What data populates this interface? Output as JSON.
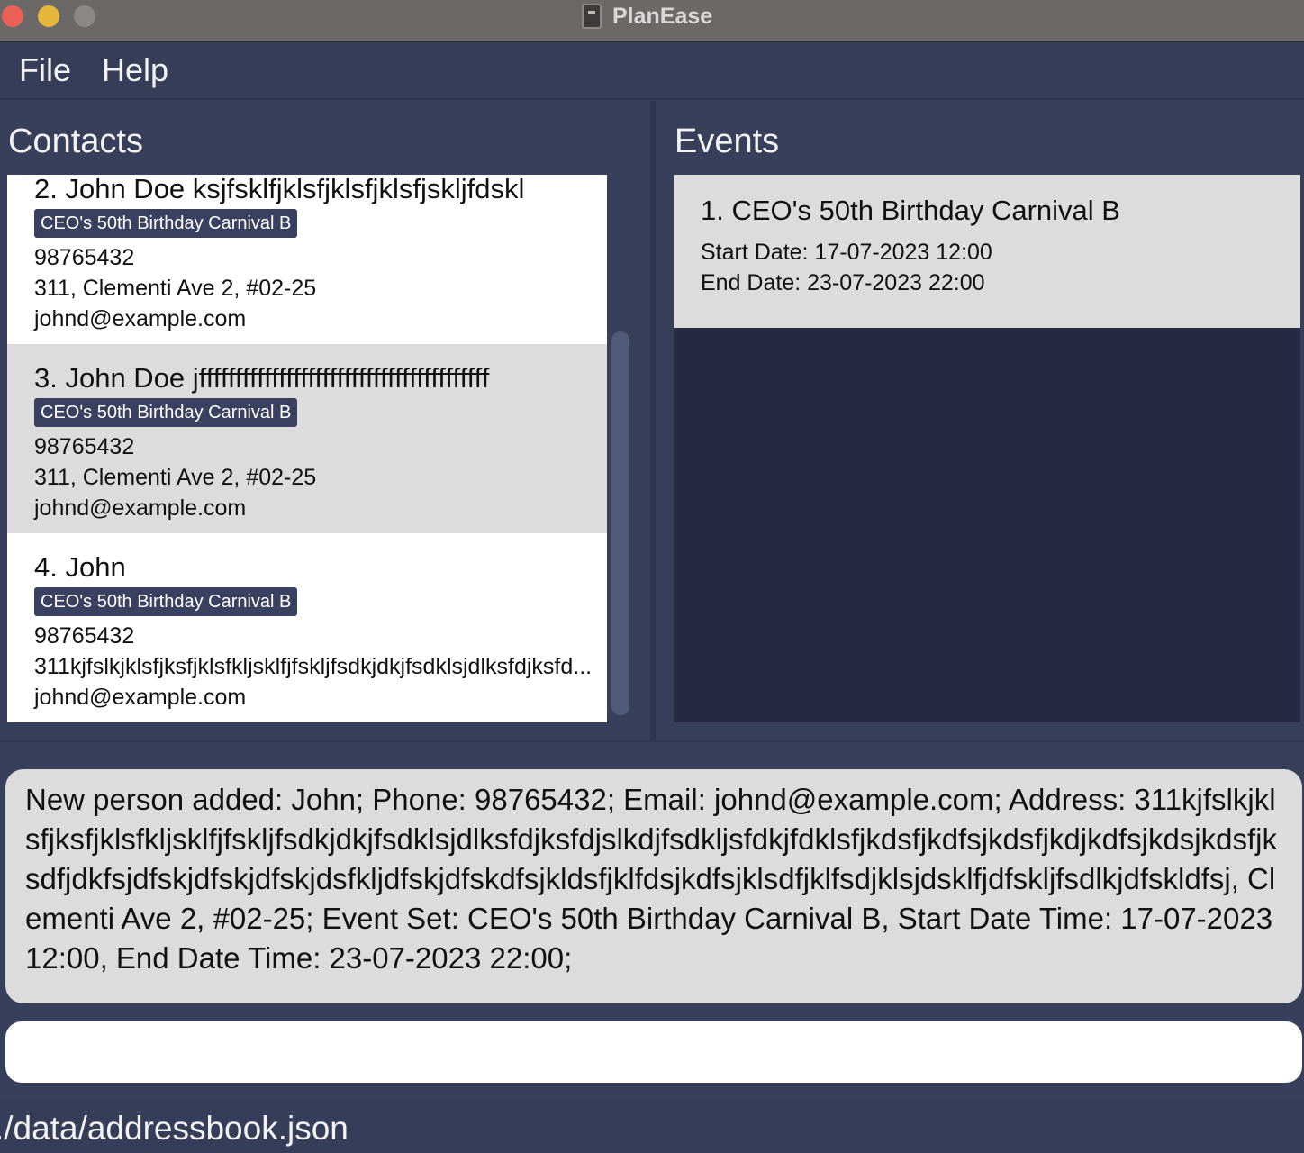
{
  "window": {
    "title": "PlanEase"
  },
  "menu": {
    "file": "File",
    "help": "Help"
  },
  "contacts_panel": {
    "title": "Contacts",
    "items": [
      {
        "name": "2.  John Doe ksjfsklfjklsfjklsfjklsfjskljfdskl",
        "tag": "CEO's 50th Birthday Carnival B",
        "phone": "98765432",
        "address": "311, Clementi Ave 2, #02-25",
        "email": "johnd@example.com"
      },
      {
        "name": "3.  John Doe  jffffffffffffffffffffffffffffffffffffffff",
        "tag": "CEO's 50th Birthday Carnival B",
        "phone": "98765432",
        "address": "311, Clementi Ave 2, #02-25",
        "email": "johnd@example.com"
      },
      {
        "name": "4.  John",
        "tag": "CEO's 50th Birthday Carnival B",
        "phone": "98765432",
        "address": "311kjfslkjklsfjksfjklsfkljsklfjfskljfsdkjdkjfsdklsjdlksfdjksfd...",
        "email": "johnd@example.com"
      }
    ]
  },
  "events_panel": {
    "title": "Events",
    "items": [
      {
        "name": "1.  CEO's 50th Birthday Carnival B",
        "start": "Start Date: 17-07-2023 12:00",
        "end": "End Date: 23-07-2023 22:00"
      }
    ]
  },
  "result": {
    "text": "New person added: John; Phone: 98765432; Email: johnd@example.com; Address: 311kjfslkjklsfjksfjklsfkljsklfjfskljfsdkjdkjfsdklsjdlksfdjksfdjslkdjfsdkljsfdkjfdklsfjkdsfjkdfsjkdsfjkdjkdfsjkdsjkdsfjksdfjdkfsjdfskjdfskjdfskjdsfkljdfskjdfskdfsjkldsfjklfdsjkdfsjklsdfjklfsdjklsjdsklfjdfskljfsdlkjdfskldfsj, Clementi Ave 2, #02-25; Event Set: CEO's 50th Birthday Carnival B, Start Date Time: 17-07-2023 12:00, End Date Time: 23-07-2023 22:00;"
  },
  "command": {
    "value": "",
    "placeholder": ""
  },
  "status": {
    "path": "./data/addressbook.json"
  },
  "colors": {
    "background": "#383f5a",
    "tag_background": "#3a4160",
    "card_alt": "#dcdcdc",
    "events_background": "#252a42"
  }
}
